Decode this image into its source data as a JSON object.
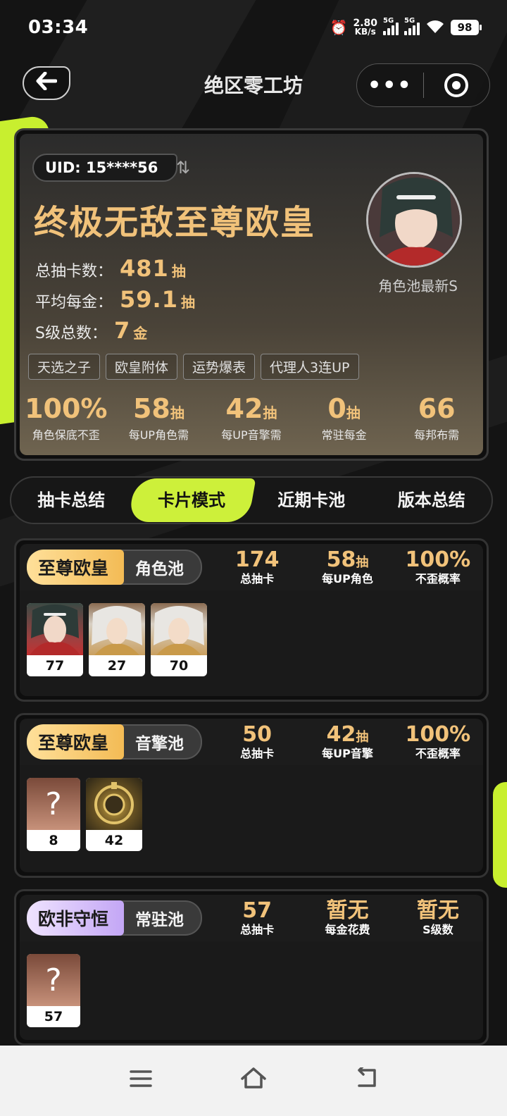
{
  "status": {
    "time": "03:34",
    "speed_value": "2.80",
    "speed_unit": "KB/s",
    "net1": "5G",
    "net2": "5G",
    "battery": "98"
  },
  "nav": {
    "title": "绝区零工坊",
    "more": "•••"
  },
  "summary": {
    "uid": "UID: 15****56",
    "title": "终极无敌至尊欧皇",
    "stats": [
      {
        "label": "总抽卡数：",
        "value": "481",
        "unit": "抽"
      },
      {
        "label": "平均每金：",
        "value": "59.1",
        "unit": "抽"
      },
      {
        "label": "S级总数：",
        "value": "7",
        "unit": "金"
      }
    ],
    "avatar_caption": "角色池最新S",
    "tags": [
      "天选之子",
      "欧皇附体",
      "运势爆表",
      "代理人3连UP"
    ],
    "metrics": [
      {
        "value": "100%",
        "unit": "",
        "label": "角色保底不歪"
      },
      {
        "value": "58",
        "unit": "抽",
        "label": "每UP角色需"
      },
      {
        "value": "42",
        "unit": "抽",
        "label": "每UP音擎需"
      },
      {
        "value": "0",
        "unit": "抽",
        "label": "常驻每金"
      },
      {
        "value": "66",
        "unit": "",
        "label": "每邦布需"
      }
    ]
  },
  "tabs": [
    "抽卡总结",
    "卡片模式",
    "近期卡池",
    "版本总结"
  ],
  "pools": [
    {
      "badge": "至尊欧皇",
      "name": "角色池",
      "stats": [
        {
          "value": "174",
          "unit": "",
          "label": "总抽卡"
        },
        {
          "value": "58",
          "unit": "抽",
          "label": "每UP角色"
        },
        {
          "value": "100%",
          "unit": "",
          "label": "不歪概率"
        }
      ],
      "cards": [
        "77",
        "27",
        "70"
      ]
    },
    {
      "badge": "至尊欧皇",
      "name": "音擎池",
      "stats": [
        {
          "value": "50",
          "unit": "",
          "label": "总抽卡"
        },
        {
          "value": "42",
          "unit": "抽",
          "label": "每UP音擎"
        },
        {
          "value": "100%",
          "unit": "",
          "label": "不歪概率"
        }
      ],
      "cards": [
        "8",
        "42"
      ],
      "unknown_mark": "?"
    },
    {
      "badge": "欧非守恒",
      "name": "常驻池",
      "stats": [
        {
          "value": "57",
          "unit": "",
          "label": "总抽卡"
        },
        {
          "value": "暂无",
          "unit": "",
          "label": "每金花费"
        },
        {
          "value": "暂无",
          "unit": "",
          "label": "S级数"
        }
      ],
      "cards": [
        "57"
      ],
      "unknown_mark": "?"
    }
  ],
  "colors": {
    "accent_lime": "#cdf03a",
    "gold": "#f1c27a",
    "badge_gold": "#f3bb55",
    "badge_purple": "#c3a6f5"
  }
}
